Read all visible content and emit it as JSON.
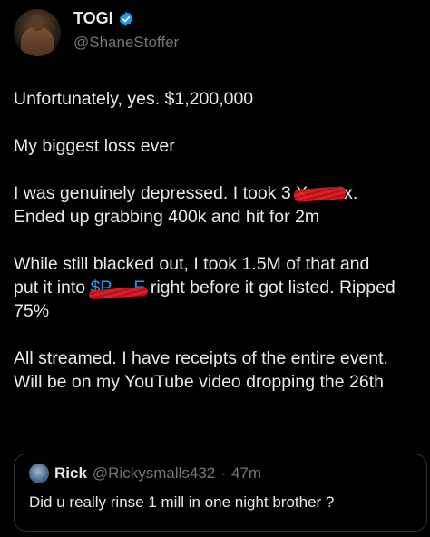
{
  "tweet": {
    "author": {
      "display_name": "TOGI",
      "handle": "@ShaneStoffer",
      "verified_icon": "verified-badge-icon",
      "avatar_icon": "profile-avatar"
    },
    "paragraphs": {
      "p1": "Unfortunately, yes. $1,200,000",
      "p2": "My biggest loss ever",
      "p3_line1_a": "I was genuinely depressed. I took 3 ",
      "p3_line1_redacted": "X",
      "p3_line1_b": "x.",
      "p3_line2": "Ended up grabbing 400k and hit for 2m",
      "p4_line1": "While still blacked out, I took 1.5M of that and",
      "p4_line2_a": "put it into ",
      "p4_line2_cashtag": "$P",
      "p4_line2_cashtag_end": "E",
      "p4_line2_b": " right before it got listed. Ripped",
      "p4_line3": "75%",
      "p5_line1": "All streamed. I have receipts of the entire event.",
      "p5_line2": "Will be on my YouTube video dropping the 26th"
    },
    "colors": {
      "background": "#000000",
      "text": "#e7e9ea",
      "secondary_text": "#71767b",
      "link": "#1d9bf0",
      "redaction": "#e0202a",
      "verified": "#1d9bf0"
    }
  },
  "quoted_tweet": {
    "display_name": "Rick",
    "handle": "@Rickysmalls432",
    "separator": "·",
    "time": "47m",
    "text": "Did u really rinse 1 mill in one night brother ?"
  }
}
